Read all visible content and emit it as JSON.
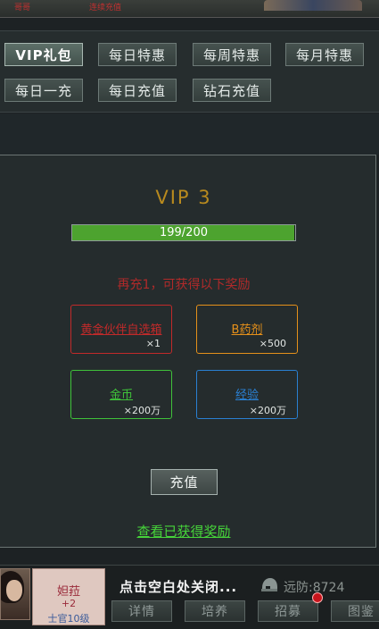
{
  "top": {
    "left_red_text": "哥哥",
    "mid_red_text": "连续充值"
  },
  "tabs": [
    {
      "label": "VIP礼包",
      "active": true
    },
    {
      "label": "每日特惠",
      "active": false
    },
    {
      "label": "每周特惠",
      "active": false
    },
    {
      "label": "每月特惠",
      "active": false
    },
    {
      "label": "每日一充",
      "active": false
    },
    {
      "label": "每日充值",
      "active": false
    },
    {
      "label": "钻石充值",
      "active": false
    }
  ],
  "vip": {
    "title": "VIP 3",
    "progress_text": "199/200",
    "progress_current": 199,
    "progress_max": 200
  },
  "hint": "再充1，可获得以下奖励",
  "rewards": [
    {
      "name": "黄金伙伴自选箱",
      "qty": "×1",
      "color": "#c22a2a"
    },
    {
      "name": "B药剂",
      "qty": "×500",
      "color": "#e5901a"
    },
    {
      "name": "金币",
      "qty": "×200万",
      "color": "#3fc23a"
    },
    {
      "name": "经验",
      "qty": "×200万",
      "color": "#2a80d2"
    }
  ],
  "charge_button": "充值",
  "view_rewards_link": "查看已获得奖励",
  "bottom": {
    "char_name": "妲菈",
    "char_level": "+2",
    "char_rank": "士官10级",
    "close_hint": "点击空白处关闭...",
    "defense_text": "远防:8724",
    "tabs": [
      "详情",
      "培养",
      "招募",
      "图鉴"
    ]
  },
  "colors": {
    "accent_gold": "#b88a1e",
    "progress_green": "#4da32f",
    "link_green": "#46d43a",
    "hint_red": "#b02a2a"
  }
}
